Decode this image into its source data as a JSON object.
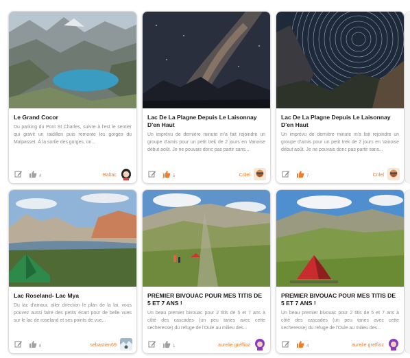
{
  "colors": {
    "accent": "#f07b2b",
    "like_inactive": "#a0a0a0",
    "like_active": "#f07b2b"
  },
  "cards": [
    {
      "title": "Le Grand Cocor",
      "description": "Du parking du Pont St Charles, suivre à l'est le sentier qui gravit un raidillon puis remonte les gorges du Malpasset. À la sortie des gorges, on...",
      "likes": "4",
      "author": "Baltac",
      "liked": false,
      "image": "mountain-lake-image",
      "avatar": "woman-avatar"
    },
    {
      "title": "Lac De La Plagne Depuis Le Laisonnay D'en Haut",
      "description": "Un imprévu de dernière minute m'a fait rejoindre un groupe d'amis pour un petit trek de 2 jours en Vanoise début août. Je ne pouvais donc pas partir sans...",
      "likes": "5",
      "author": "Cnlel",
      "liked": true,
      "image": "milky-way-image",
      "avatar": "bearded-man-avatar"
    },
    {
      "title": "Lac De La Plagne Depuis Le Laisonnay D'en Haut",
      "description": "Un imprévu de dernière minute m'a fait rejoindre un groupe d'amis pour un petit trek de 2 jours en Vanoise début août. Je ne pouvais donc pas partir sans...",
      "likes": "7",
      "author": "Cnlel",
      "liked": true,
      "image": "star-trails-image",
      "avatar": "bearded-man-avatar"
    },
    {
      "title": "Lac Roseland- Lac Mya",
      "description": "Du lac d'amour, aller direction le plan de la lai, vous pouvez aussi faire des petits écart pour de belle vues sur le lac de roseland et ses points de vue...",
      "likes": "6",
      "author": "sebastien69",
      "liked": false,
      "image": "lake-tent-image",
      "avatar": "snowy-avatar"
    },
    {
      "title": "PREMIER BIVOUAC POUR MES TITIS DE 5 ET 7 ANS !",
      "description": "Un beau premier bivouac pour 2 titis de 5 et 7 ans à côté des cascades (un peu taries avec cette secheresse) du refuge de l'Oule au milieu des...",
      "likes": "1",
      "author": "aurelie greffioz",
      "liked": false,
      "image": "valley-hikers-image",
      "avatar": "purple-hair-avatar"
    },
    {
      "title": "PREMIER BIVOUAC POUR MES TITIS DE 5 ET 7 ANS !",
      "description": "Un beau premier bivouac pour 2 titis de 5 et 7 ans à côté des cascades (un peu taries avec cette secheresse) du refuge de l'Oule au milieu des...",
      "likes": "4",
      "author": "aurelie greffioz",
      "liked": true,
      "image": "valley-red-tent-image",
      "avatar": "purple-hair-avatar"
    }
  ]
}
